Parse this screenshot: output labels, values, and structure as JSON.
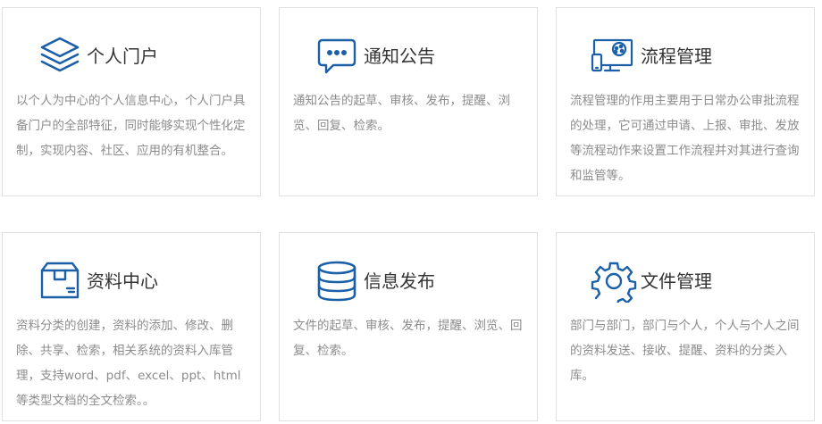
{
  "cards": [
    {
      "title": "个人门户",
      "icon": "layers-icon",
      "description": "以个人为中心的个人信息中心，个人门户具备门户的全部特征，同时能够实现个性化定制，实现内容、社区、应用的有机整合。"
    },
    {
      "title": "通知公告",
      "icon": "chat-bubble-icon",
      "description": "通知公告的起草、审核、发布，提醒、浏览、回复、检索。"
    },
    {
      "title": "流程管理",
      "icon": "monitor-workflow-icon",
      "description": "流程管理的作用主要用于日常办公审批流程的处理，它可通过申请、上报、审批、发放等流程动作来设置工作流程并对其进行查询和监管等。"
    },
    {
      "title": "资料中心",
      "icon": "box-icon",
      "description": "资料分类的创建，资料的添加、修改、删除、共享、检索，相关系统的资料入库管理，支持word、pdf、excel、ppt、html等类型文档的全文检索。。"
    },
    {
      "title": "信息发布",
      "icon": "database-icon",
      "description": "文件的起草、审核、发布，提醒、浏览、回复、检索。"
    },
    {
      "title": "文件管理",
      "icon": "gear-icon",
      "description": "部门与部门，部门与个人，个人与个人之间的资料发送、接收、提醒、资料的分类入库。"
    }
  ],
  "colors": {
    "icon": "#1a5fa8",
    "title": "#333333",
    "description": "#8c8c8c",
    "border": "#e0e0e0"
  }
}
